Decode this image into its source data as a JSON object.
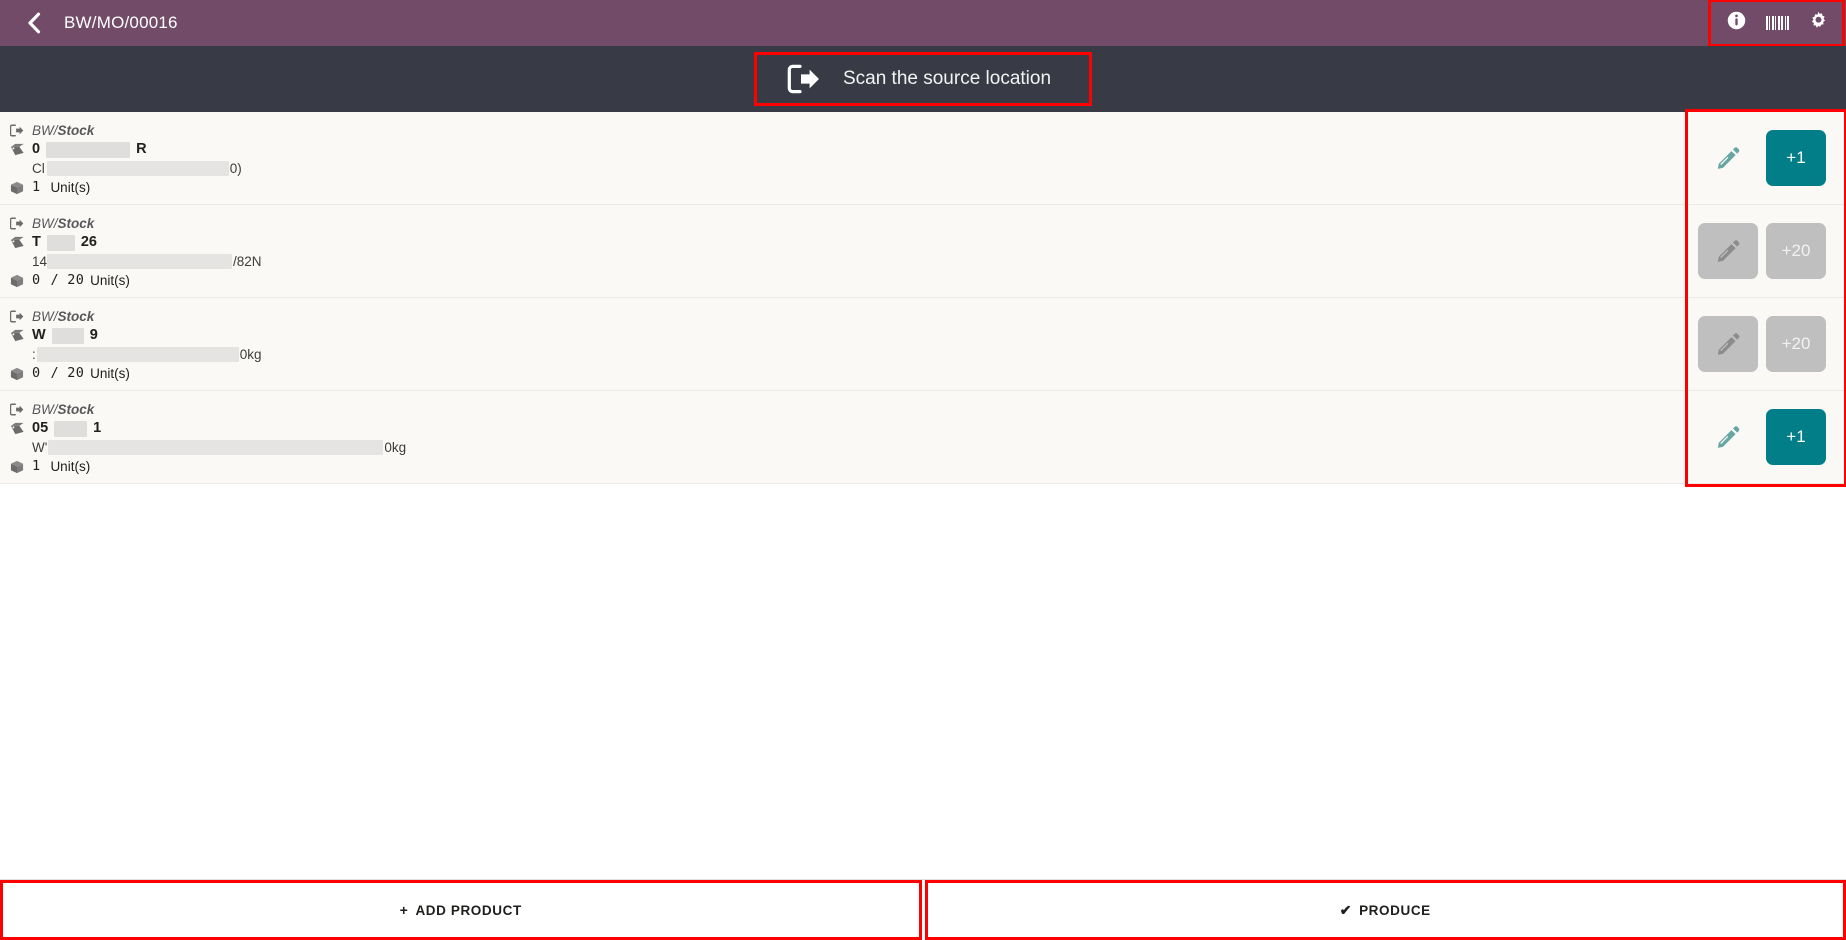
{
  "header": {
    "back_icon": "chevron-left-icon",
    "title": "BW/MO/00016",
    "actions": [
      {
        "icon": "info-icon",
        "name": "info-button"
      },
      {
        "icon": "barcode-icon",
        "name": "barcode-button"
      },
      {
        "icon": "gear-icon",
        "name": "settings-button"
      }
    ]
  },
  "scan_banner": {
    "icon": "scan-exit-icon",
    "text": "Scan the source location"
  },
  "colors": {
    "header_purple": "#714B67",
    "banner_dark": "#383B45",
    "list_bg": "#FBF9F6",
    "accent_teal": "#017E87",
    "disabled_gray": "#BFBFBF",
    "highlight_red": "#FF0000"
  },
  "rows": [
    {
      "location_icon": "sign-out-icon",
      "location_prefix": "BW/",
      "location_name": "Stock",
      "product_icon": "tag-icon",
      "product_prefix": "0",
      "product_suffix": "R",
      "product_redacted": true,
      "description_prefix": "Cl",
      "description_suffix": "0)",
      "description_redacted": true,
      "quantity_icon": "box-icon",
      "quantity": "1",
      "quantity_demand": "",
      "unit": "Unit(s)",
      "edit_enabled": true,
      "edit_icon": "pencil-icon",
      "qty_button_label": "+1",
      "qty_button_enabled": true
    },
    {
      "location_icon": "sign-out-icon",
      "location_prefix": "BW/",
      "location_name": "Stock",
      "product_icon": "tag-icon",
      "product_prefix": "T",
      "product_suffix": "26",
      "product_redacted": true,
      "description_prefix": "14",
      "description_suffix": "/82N",
      "description_redacted": true,
      "quantity_icon": "box-icon",
      "quantity": "0",
      "quantity_demand": "/ 20",
      "unit": "Unit(s)",
      "edit_enabled": false,
      "edit_icon": "pencil-icon",
      "qty_button_label": "+20",
      "qty_button_enabled": false
    },
    {
      "location_icon": "sign-out-icon",
      "location_prefix": "BW/",
      "location_name": "Stock",
      "product_icon": "tag-icon",
      "product_prefix": "W",
      "product_suffix": "9",
      "product_redacted": true,
      "description_prefix": ":",
      "description_suffix": "0kg",
      "description_redacted": true,
      "quantity_icon": "box-icon",
      "quantity": "0",
      "quantity_demand": "/ 20",
      "unit": "Unit(s)",
      "edit_enabled": false,
      "edit_icon": "pencil-icon",
      "qty_button_label": "+20",
      "qty_button_enabled": false
    },
    {
      "location_icon": "sign-out-icon",
      "location_prefix": "BW/",
      "location_name": "Stock",
      "product_icon": "tag-icon",
      "product_prefix": "05",
      "product_suffix": "1",
      "product_redacted": true,
      "description_prefix": "W'",
      "description_suffix": "0kg",
      "description_redacted": true,
      "quantity_icon": "box-icon",
      "quantity": "1",
      "quantity_demand": "",
      "unit": "Unit(s)",
      "edit_enabled": true,
      "edit_icon": "pencil-icon",
      "qty_button_label": "+1",
      "qty_button_enabled": true
    }
  ],
  "footer": {
    "add_product": {
      "glyph": "+",
      "label": "ADD PRODUCT"
    },
    "produce": {
      "glyph": "✔",
      "label": "PRODUCE"
    }
  }
}
